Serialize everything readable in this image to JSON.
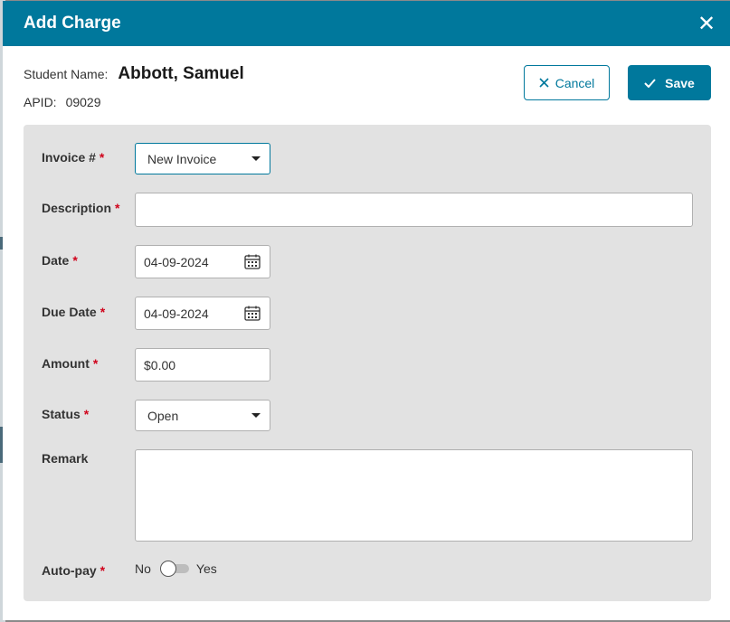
{
  "dialog": {
    "title": "Add Charge",
    "close_glyph": "✕"
  },
  "student": {
    "name_label": "Student Name:",
    "name": "Abbott, Samuel",
    "apid_label": "APID:",
    "apid": "09029"
  },
  "actions": {
    "cancel_label": "Cancel",
    "cancel_icon": "close-icon",
    "save_label": "Save",
    "save_icon": "check-icon"
  },
  "form": {
    "required_mark": "*",
    "invoice": {
      "label": "Invoice #",
      "value": "New Invoice"
    },
    "description": {
      "label": "Description",
      "value": ""
    },
    "date": {
      "label": "Date",
      "value": "04-09-2024"
    },
    "due_date": {
      "label": "Due Date",
      "value": "04-09-2024"
    },
    "amount": {
      "label": "Amount",
      "value": "$0.00"
    },
    "status": {
      "label": "Status",
      "value": "Open"
    },
    "remark": {
      "label": "Remark",
      "value": ""
    },
    "autopay": {
      "label": "Auto-pay",
      "off_label": "No",
      "on_label": "Yes",
      "enabled": false
    }
  },
  "colors": {
    "accent": "#00789c",
    "panel": "#e2e2e2",
    "required": "#d0021b"
  }
}
